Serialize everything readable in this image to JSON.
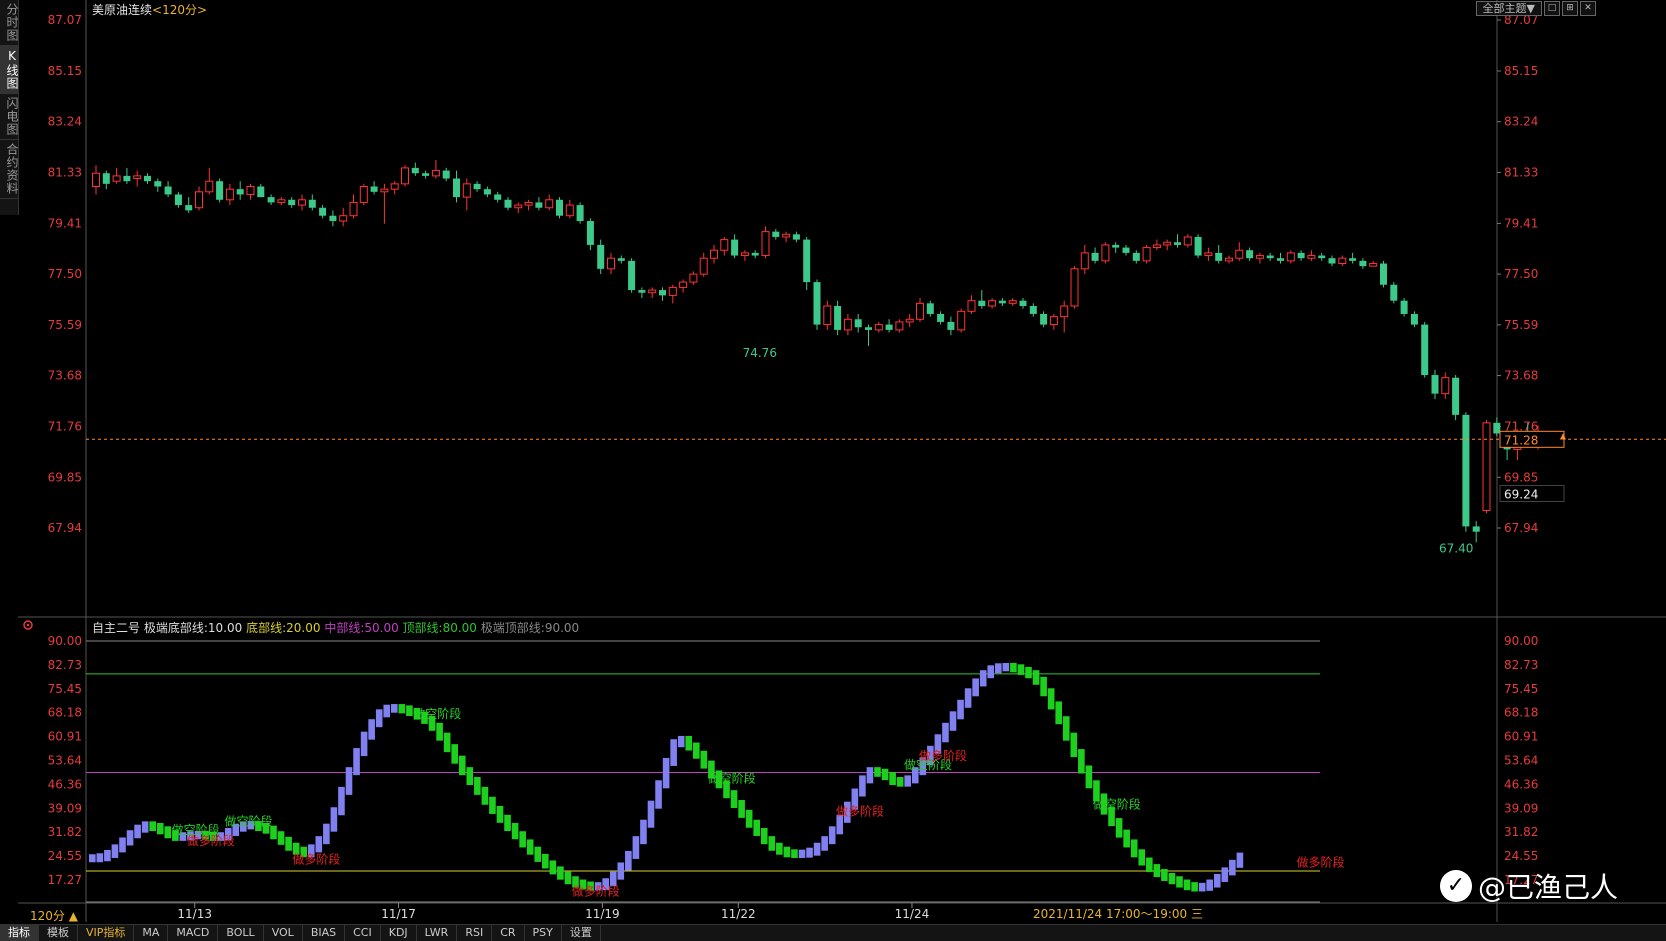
{
  "left_tabs": [
    "分时图",
    "K线图",
    "闪电图",
    "合约资料"
  ],
  "left_tab_active": 1,
  "title": {
    "symbol": "美原油连续",
    "period": "<120分>"
  },
  "top_right": {
    "theme": "全部主题▼",
    "buttons": [
      "□",
      "⊞",
      "✕"
    ]
  },
  "main_axis": {
    "ticks": [
      "87.07",
      "85.15",
      "83.24",
      "81.33",
      "79.41",
      "77.50",
      "75.59",
      "73.68",
      "71.76",
      "69.85",
      "67.94"
    ],
    "min": 67.94,
    "max": 87.07
  },
  "price_markers": {
    "last_price": "71.28",
    "box2": "69.24",
    "low_label": "67.40",
    "mid_low_label": "74.76"
  },
  "indicator_bar": {
    "name": "自主二号",
    "extreme_bottom": "极端底部线:10.00",
    "bottom": "底部线:20.00",
    "middle": "中部线:50.00",
    "top": "顶部线:80.00",
    "extreme_top": "极端顶部线:90.00"
  },
  "sub_axis": {
    "ticks": [
      "90.00",
      "82.73",
      "75.45",
      "68.18",
      "60.91",
      "53.64",
      "46.36",
      "39.09",
      "31.82",
      "24.55",
      "17.27"
    ],
    "min": 17.27,
    "max": 90.0
  },
  "sub_labels": [
    {
      "text": "做空阶段",
      "bar": 12,
      "color": "#25d025",
      "dy": -12
    },
    {
      "text": "做多阶段",
      "bar": 14,
      "color": "#e62020",
      "dy": 0
    },
    {
      "text": "做空阶段",
      "bar": 19,
      "color": "#25d025",
      "dy": -12
    },
    {
      "text": "做多阶段",
      "bar": 28,
      "color": "#e62020",
      "dy": 0
    },
    {
      "text": "做空阶段",
      "bar": 44,
      "color": "#25d025",
      "dy": -12
    },
    {
      "text": "做多阶段",
      "bar": 65,
      "color": "#e62020",
      "dy": 0
    },
    {
      "text": "做空阶段",
      "bar": 83,
      "color": "#25d025",
      "dy": -12
    },
    {
      "text": "做多阶段",
      "bar": 100,
      "color": "#e62020",
      "dy": 0
    },
    {
      "text": "做空阶段",
      "bar": 109,
      "color": "#25d025",
      "dy": -12
    },
    {
      "text": "做多阶段",
      "bar": 111,
      "color": "#e62020",
      "dy": 0
    },
    {
      "text": "做空阶段",
      "bar": 134,
      "color": "#25d025",
      "dy": -12
    },
    {
      "text": "做多阶段",
      "bar": 161,
      "color": "#e62020",
      "dy": 0
    }
  ],
  "date_axis": [
    {
      "label": "11/13",
      "bar": 14
    },
    {
      "label": "11/17",
      "bar": 41
    },
    {
      "label": "11/19",
      "bar": 68
    },
    {
      "label": "11/22",
      "bar": 86
    },
    {
      "label": "11/24",
      "bar": 109
    }
  ],
  "date_tooltip": "2021/11/24 17:00～19:00 三",
  "period_button": "120分 ▲",
  "bottom_tabs": [
    "指标",
    "模板",
    "VIP指标",
    "MA",
    "MACD",
    "BOLL",
    "VOL",
    "BIAS",
    "CCI",
    "KDJ",
    "LWR",
    "RSI",
    "CR",
    "PSY",
    "设置"
  ],
  "bottom_tab_active": 0,
  "watermark": "@已渔己人",
  "colors": {
    "up": "#ff3333",
    "down": "#3cc98a",
    "axis_text": "#e63b3b",
    "dashed": "#ff8a2b",
    "sub_purple": "#8080f0",
    "sub_green": "#1ed01e",
    "line_top": "#34c234",
    "line_mid": "#c040c0",
    "line_bot": "#d8d030",
    "line_xtop": "#888888"
  },
  "chart_data": [
    {
      "type": "candlestick",
      "title": "美原油连续 <120分>",
      "ylim": [
        67.94,
        87.07
      ],
      "ohlc": [
        [
          80.8,
          81.6,
          80.5,
          81.3
        ],
        [
          81.3,
          81.4,
          80.7,
          80.9
        ],
        [
          81.0,
          81.5,
          80.9,
          81.2
        ],
        [
          81.2,
          81.5,
          80.9,
          81.0
        ],
        [
          81.1,
          81.4,
          80.8,
          81.2
        ],
        [
          81.2,
          81.3,
          80.9,
          81.0
        ],
        [
          81.0,
          81.1,
          80.6,
          80.8
        ],
        [
          80.8,
          81.0,
          80.4,
          80.5
        ],
        [
          80.5,
          80.6,
          80.0,
          80.1
        ],
        [
          80.1,
          80.4,
          79.8,
          79.9
        ],
        [
          80.0,
          80.8,
          79.9,
          80.6
        ],
        [
          80.6,
          81.5,
          80.5,
          81.0
        ],
        [
          81.0,
          81.1,
          80.2,
          80.3
        ],
        [
          80.3,
          80.9,
          80.1,
          80.7
        ],
        [
          80.7,
          81.0,
          80.3,
          80.5
        ],
        [
          80.5,
          80.9,
          80.3,
          80.8
        ],
        [
          80.8,
          80.9,
          80.4,
          80.4
        ],
        [
          80.4,
          80.5,
          80.1,
          80.2
        ],
        [
          80.2,
          80.4,
          80.1,
          80.3
        ],
        [
          80.3,
          80.4,
          80.0,
          80.1
        ],
        [
          80.1,
          80.5,
          79.9,
          80.3
        ],
        [
          80.3,
          80.5,
          79.9,
          80.0
        ],
        [
          80.0,
          80.1,
          79.6,
          79.7
        ],
        [
          79.7,
          79.9,
          79.3,
          79.5
        ],
        [
          79.5,
          80.0,
          79.3,
          79.7
        ],
        [
          79.7,
          80.5,
          79.6,
          80.2
        ],
        [
          80.2,
          80.9,
          80.1,
          80.8
        ],
        [
          80.8,
          81.0,
          80.5,
          80.6
        ],
        [
          80.6,
          80.9,
          79.4,
          80.7
        ],
        [
          80.7,
          81.0,
          80.5,
          80.9
        ],
        [
          80.9,
          81.6,
          80.8,
          81.5
        ],
        [
          81.5,
          81.7,
          81.2,
          81.3
        ],
        [
          81.3,
          81.4,
          81.1,
          81.2
        ],
        [
          81.2,
          81.8,
          81.1,
          81.4
        ],
        [
          81.4,
          81.5,
          81.0,
          81.1
        ],
        [
          81.1,
          81.4,
          80.2,
          80.4
        ],
        [
          80.4,
          81.1,
          79.9,
          80.9
        ],
        [
          80.9,
          81.0,
          80.6,
          80.7
        ],
        [
          80.7,
          80.8,
          80.4,
          80.5
        ],
        [
          80.5,
          80.6,
          80.2,
          80.3
        ],
        [
          80.3,
          80.4,
          79.9,
          80.0
        ],
        [
          80.0,
          80.2,
          79.8,
          80.1
        ],
        [
          80.1,
          80.3,
          79.9,
          80.2
        ],
        [
          80.2,
          80.4,
          79.9,
          80.0
        ],
        [
          80.0,
          80.5,
          79.9,
          80.3
        ],
        [
          80.3,
          80.4,
          79.6,
          79.7
        ],
        [
          79.7,
          80.3,
          79.6,
          80.1
        ],
        [
          80.1,
          80.2,
          79.4,
          79.5
        ],
        [
          79.5,
          79.6,
          78.4,
          78.6
        ],
        [
          78.6,
          78.8,
          77.5,
          77.7
        ],
        [
          77.7,
          78.3,
          77.5,
          78.1
        ],
        [
          78.1,
          78.2,
          77.9,
          78.0
        ],
        [
          78.0,
          78.1,
          76.8,
          76.9
        ],
        [
          76.9,
          77.0,
          76.6,
          76.8
        ],
        [
          76.8,
          77.0,
          76.6,
          76.9
        ],
        [
          76.9,
          77.0,
          76.5,
          76.7
        ],
        [
          76.7,
          77.1,
          76.4,
          77.0
        ],
        [
          77.0,
          77.3,
          76.8,
          77.2
        ],
        [
          77.2,
          77.6,
          77.1,
          77.5
        ],
        [
          77.5,
          78.3,
          77.4,
          78.1
        ],
        [
          78.1,
          78.6,
          77.9,
          78.4
        ],
        [
          78.4,
          78.9,
          78.2,
          78.8
        ],
        [
          78.8,
          79.0,
          78.1,
          78.2
        ],
        [
          78.2,
          78.4,
          78.0,
          78.3
        ],
        [
          78.3,
          78.4,
          78.1,
          78.2
        ],
        [
          78.2,
          79.3,
          78.1,
          79.1
        ],
        [
          79.1,
          79.2,
          78.8,
          78.9
        ],
        [
          78.9,
          79.1,
          78.7,
          79.0
        ],
        [
          79.0,
          79.1,
          78.7,
          78.8
        ],
        [
          78.8,
          78.9,
          76.9,
          77.2
        ],
        [
          77.2,
          77.3,
          75.4,
          75.6
        ],
        [
          75.6,
          76.5,
          75.4,
          76.3
        ],
        [
          76.3,
          76.5,
          75.2,
          75.4
        ],
        [
          75.4,
          76.0,
          75.2,
          75.8
        ],
        [
          75.8,
          76.0,
          75.3,
          75.5
        ],
        [
          75.5,
          75.6,
          74.8,
          75.4
        ],
        [
          75.4,
          75.7,
          75.3,
          75.6
        ],
        [
          75.6,
          75.8,
          75.3,
          75.4
        ],
        [
          75.4,
          75.8,
          75.3,
          75.7
        ],
        [
          75.7,
          76.0,
          75.5,
          75.8
        ],
        [
          75.8,
          76.6,
          75.7,
          76.4
        ],
        [
          76.4,
          76.5,
          75.9,
          76.0
        ],
        [
          76.0,
          76.1,
          75.6,
          75.7
        ],
        [
          75.7,
          75.9,
          75.2,
          75.4
        ],
        [
          75.4,
          76.2,
          75.3,
          76.1
        ],
        [
          76.1,
          76.7,
          76.0,
          76.5
        ],
        [
          76.5,
          76.9,
          76.2,
          76.3
        ],
        [
          76.3,
          76.6,
          76.2,
          76.5
        ],
        [
          76.5,
          76.6,
          76.3,
          76.4
        ],
        [
          76.4,
          76.6,
          76.3,
          76.5
        ],
        [
          76.5,
          76.6,
          76.2,
          76.3
        ],
        [
          76.3,
          76.4,
          75.9,
          76.0
        ],
        [
          76.0,
          76.1,
          75.5,
          75.6
        ],
        [
          75.6,
          76.0,
          75.4,
          75.9
        ],
        [
          75.9,
          76.5,
          75.3,
          76.3
        ],
        [
          76.3,
          77.8,
          76.2,
          77.7
        ],
        [
          77.7,
          78.6,
          77.5,
          78.3
        ],
        [
          78.3,
          78.5,
          77.9,
          78.0
        ],
        [
          78.0,
          78.7,
          77.9,
          78.6
        ],
        [
          78.6,
          78.7,
          78.3,
          78.5
        ],
        [
          78.5,
          78.6,
          78.2,
          78.3
        ],
        [
          78.3,
          78.4,
          77.9,
          78.0
        ],
        [
          78.0,
          78.6,
          77.9,
          78.5
        ],
        [
          78.5,
          78.8,
          78.4,
          78.6
        ],
        [
          78.6,
          78.8,
          78.4,
          78.7
        ],
        [
          78.7,
          79.0,
          78.5,
          78.6
        ],
        [
          78.6,
          79.0,
          78.5,
          78.9
        ],
        [
          78.9,
          79.0,
          78.1,
          78.2
        ],
        [
          78.2,
          78.5,
          78.0,
          78.3
        ],
        [
          78.3,
          78.6,
          77.9,
          78.0
        ],
        [
          78.0,
          78.2,
          77.9,
          78.1
        ],
        [
          78.1,
          78.7,
          78.0,
          78.4
        ],
        [
          78.4,
          78.5,
          78.0,
          78.1
        ],
        [
          78.1,
          78.3,
          77.9,
          78.2
        ],
        [
          78.2,
          78.3,
          78.0,
          78.1
        ],
        [
          78.1,
          78.3,
          77.9,
          78.0
        ],
        [
          78.0,
          78.4,
          77.9,
          78.3
        ],
        [
          78.3,
          78.4,
          78.0,
          78.1
        ],
        [
          78.1,
          78.4,
          78.0,
          78.2
        ],
        [
          78.2,
          78.3,
          78.0,
          78.1
        ],
        [
          78.1,
          78.2,
          77.8,
          77.9
        ],
        [
          77.9,
          78.2,
          77.8,
          78.1
        ],
        [
          78.1,
          78.3,
          77.9,
          78.0
        ],
        [
          78.0,
          78.1,
          77.7,
          77.8
        ],
        [
          77.8,
          78.0,
          77.8,
          77.9
        ],
        [
          77.9,
          78.0,
          77.0,
          77.1
        ],
        [
          77.1,
          77.2,
          76.4,
          76.5
        ],
        [
          76.5,
          76.6,
          75.9,
          76.0
        ],
        [
          76.0,
          76.1,
          75.5,
          75.6
        ],
        [
          75.6,
          75.7,
          73.6,
          73.7
        ],
        [
          73.7,
          73.9,
          72.8,
          73.0
        ],
        [
          73.0,
          73.8,
          72.8,
          73.6
        ],
        [
          73.6,
          73.7,
          72.0,
          72.2
        ],
        [
          72.2,
          72.3,
          67.8,
          68.0
        ],
        [
          68.0,
          68.2,
          67.4,
          67.8
        ],
        [
          68.6,
          72.0,
          68.5,
          71.9
        ],
        [
          71.9,
          72.1,
          71.4,
          71.5
        ],
        [
          71.5,
          71.6,
          70.5,
          70.9
        ],
        [
          70.9,
          71.6,
          70.5,
          71.5
        ],
        [
          71.5,
          71.9,
          71.1,
          71.2
        ],
        [
          71.2,
          71.8,
          70.9,
          71.28
        ]
      ]
    },
    {
      "type": "bar",
      "title": "自主二号",
      "ylim": [
        17.27,
        90.0
      ],
      "reference_lines": [
        {
          "name": "极端顶部线",
          "value": 90.0
        },
        {
          "name": "顶部线",
          "value": 80.0
        },
        {
          "name": "中部线",
          "value": 50.0
        },
        {
          "name": "底部线",
          "value": 20.0
        },
        {
          "name": "极端底部线",
          "value": 10.0
        }
      ],
      "values": [
        24.5,
        24.8,
        25.8,
        27.5,
        29.6,
        31.8,
        33.5,
        34.5,
        34.0,
        33.0,
        31.8,
        31.0,
        31.2,
        31.5,
        31.6,
        31.4,
        31.0,
        31.2,
        32.5,
        33.8,
        34.5,
        34.6,
        34.0,
        33.2,
        31.5,
        29.8,
        28.0,
        26.8,
        26.0,
        27.5,
        30.0,
        33.8,
        38.8,
        45.0,
        51.0,
        56.8,
        61.8,
        65.6,
        68.6,
        70.0,
        70.2,
        69.8,
        69.0,
        67.9,
        66.6,
        64.5,
        61.5,
        58.0,
        54.5,
        51.0,
        48.0,
        45.0,
        42.0,
        39.2,
        36.5,
        34.0,
        31.5,
        29.0,
        26.8,
        24.6,
        22.6,
        20.8,
        19.2,
        17.8,
        16.8,
        16.2,
        15.9,
        16.0,
        17.2,
        19.2,
        22.0,
        25.5,
        30.0,
        35.0,
        40.8,
        47.0,
        53.8,
        59.5,
        60.5,
        58.5,
        56.0,
        53.0,
        50.0,
        47.0,
        44.0,
        41.0,
        38.0,
        35.0,
        32.5,
        30.0,
        28.0,
        26.8,
        26.0,
        25.8,
        25.9,
        26.5,
        28.0,
        30.0,
        33.0,
        36.5,
        40.5,
        44.5,
        48.5,
        51.0,
        50.5,
        49.5,
        48.0,
        47.5,
        48.5,
        51.0,
        54.0,
        57.5,
        61.0,
        64.5,
        68.0,
        71.5,
        75.0,
        78.0,
        80.5,
        82.0,
        82.6,
        82.7,
        82.3,
        81.5,
        80.5,
        78.5,
        75.0,
        71.0,
        66.5,
        61.5,
        56.5,
        51.5,
        47.0,
        43.0,
        39.0,
        35.5,
        32.0,
        29.0,
        26.0,
        23.5,
        21.5,
        20.0,
        18.8,
        17.8,
        16.8,
        16.0,
        15.6,
        15.8,
        16.8,
        18.5,
        20.5,
        22.8,
        25.0
      ],
      "up_flags": "purple=rising, green=falling"
    }
  ]
}
